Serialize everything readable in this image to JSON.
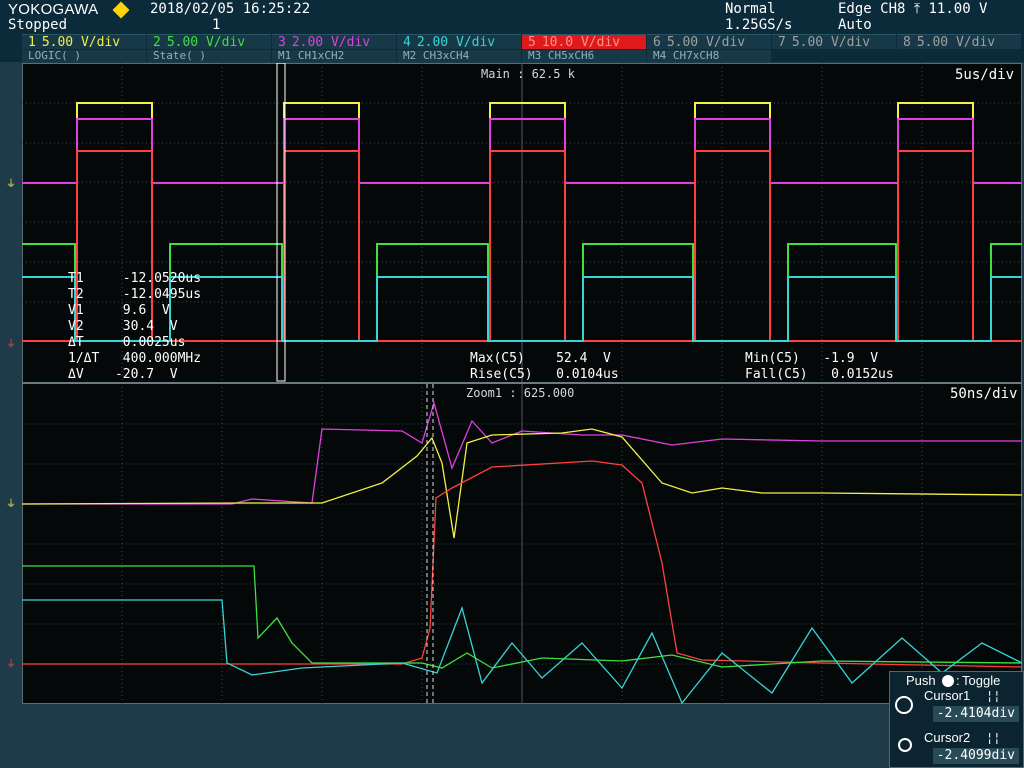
{
  "header": {
    "brand": "YOKOGAWA",
    "status": "Stopped",
    "datetime": "2018/02/05  16:25:22",
    "acq_count": "1",
    "mode": "Normal",
    "sample_rate": "1.25GS/s",
    "trigger": "Edge CH8  ⤒  11.00 V",
    "trigger_mode": "Auto"
  },
  "channels": [
    {
      "num": "1",
      "scale": "5.00 V/div",
      "color": "#f3f04a"
    },
    {
      "num": "2",
      "scale": "5.00 V/div",
      "color": "#3ee03e"
    },
    {
      "num": "3",
      "scale": "2.00 V/div",
      "color": "#e040e0"
    },
    {
      "num": "4",
      "scale": "2.00 V/div",
      "color": "#36d6d6"
    },
    {
      "num": "5",
      "scale": "10.0 V/div",
      "color": "#ff4040"
    },
    {
      "num": "6",
      "scale": "5.00 V/div",
      "color": "#a0a0a0"
    },
    {
      "num": "7",
      "scale": "5.00 V/div",
      "color": "#a0a0a0"
    },
    {
      "num": "8",
      "scale": "5.00 V/div",
      "color": "#a0a0a0"
    }
  ],
  "tabs": [
    "LOGIC(  )",
    "State(  )",
    "M1 CH1xCH2",
    "M2 CH3xCH4",
    "M3 CH5xCH6",
    "M4 CH7xCH8"
  ],
  "main": {
    "label": "Main : 62.5 k",
    "timebase": "5us/div"
  },
  "zoom": {
    "label": "Zoom1 : 625.000",
    "timebase": "50ns/div"
  },
  "cursor_readout": {
    "t1": "T1     -12.0520us",
    "t2": "T2     -12.0495us",
    "v1": "V1     9.6  V",
    "v2": "V2     30.4  V",
    "dt": "ΔT     0.0025us",
    "inv": "1/ΔT   400.000MHz",
    "dv": "ΔV    -20.7  V"
  },
  "measurements": {
    "max": "Max(C5)    52.4  V",
    "rise": "Rise(C5)   0.0104us",
    "min": "Min(C5)   -1.9  V",
    "fall": "Fall(C5)   0.0152us"
  },
  "push_panel": {
    "title": "Push",
    "toggle": "Toggle",
    "cursor1": "Cursor1",
    "cursor1_val": "-2.4104div",
    "cursor2": "Cursor2",
    "cursor2_val": "-2.4099div"
  }
}
